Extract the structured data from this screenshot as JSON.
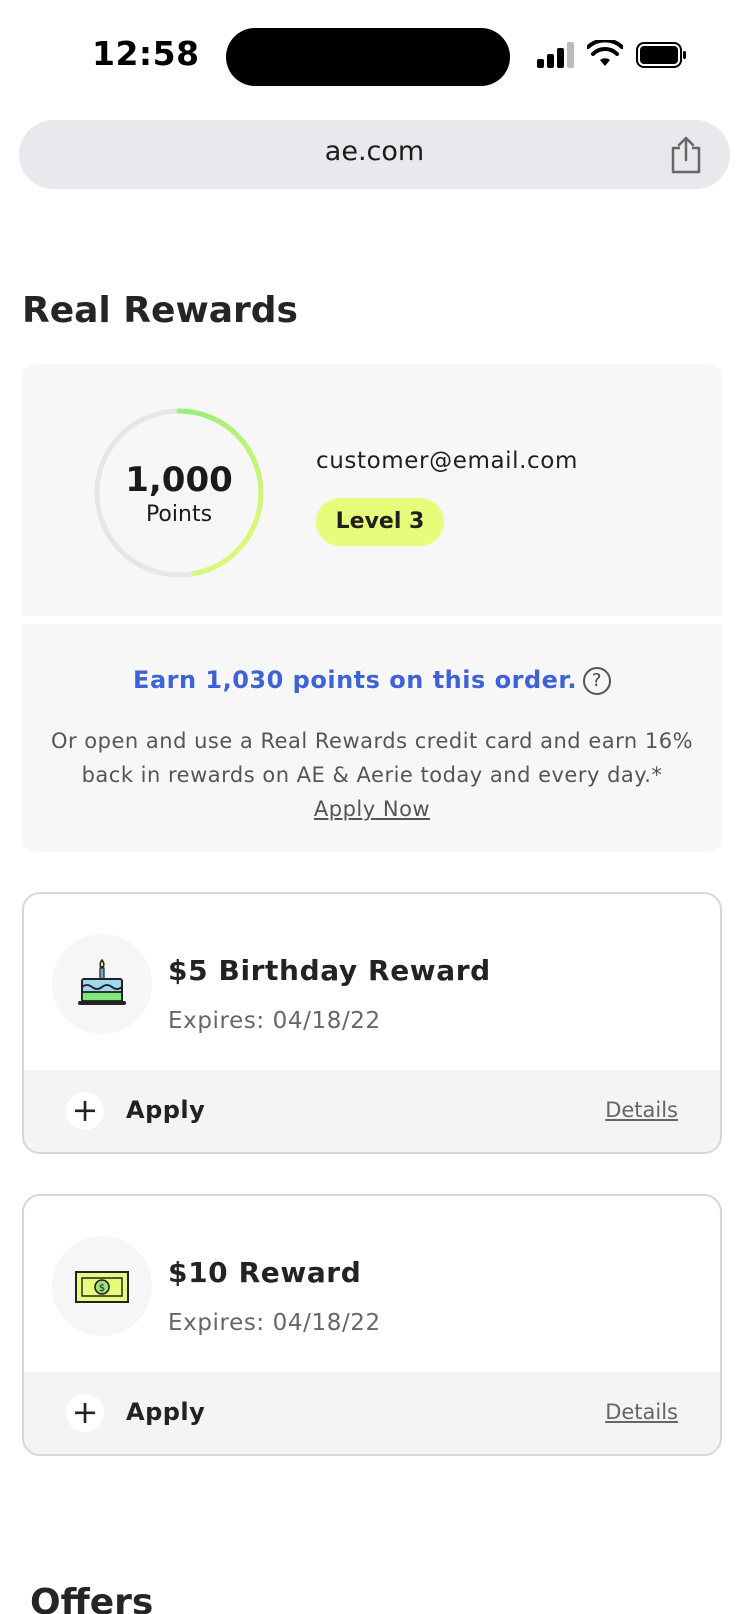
{
  "status": {
    "time": "12:58"
  },
  "browser": {
    "url": "ae.com"
  },
  "page": {
    "title": "Real Rewards",
    "offers_title": "Offers"
  },
  "summary": {
    "points_value": "1,000",
    "points_label": "Points",
    "points_progress": 0.47,
    "email": "customer@email.com",
    "level": "Level 3"
  },
  "earn": {
    "headline": "Earn 1,030 points on this order.",
    "help_glyph": "?",
    "description": "Or open and use a Real Rewards credit card and earn 16% back in rewards on AE & Aerie today and every day.*",
    "apply_now": "Apply Now"
  },
  "rewards": [
    {
      "icon": "birthday-cake-icon",
      "title": "$5 Birthday Reward",
      "expiry": "Expires: 04/18/22",
      "apply": "Apply",
      "details": "Details"
    },
    {
      "icon": "cash-bill-icon",
      "title": "$10 Reward",
      "expiry": "Expires: 04/18/22",
      "apply": "Apply",
      "details": "Details"
    }
  ],
  "colors": {
    "accent_blue": "#3d63d6",
    "level_badge": "#e8fb7a",
    "ring_start": "#e8fb7a",
    "ring_end": "#7ee87a"
  }
}
